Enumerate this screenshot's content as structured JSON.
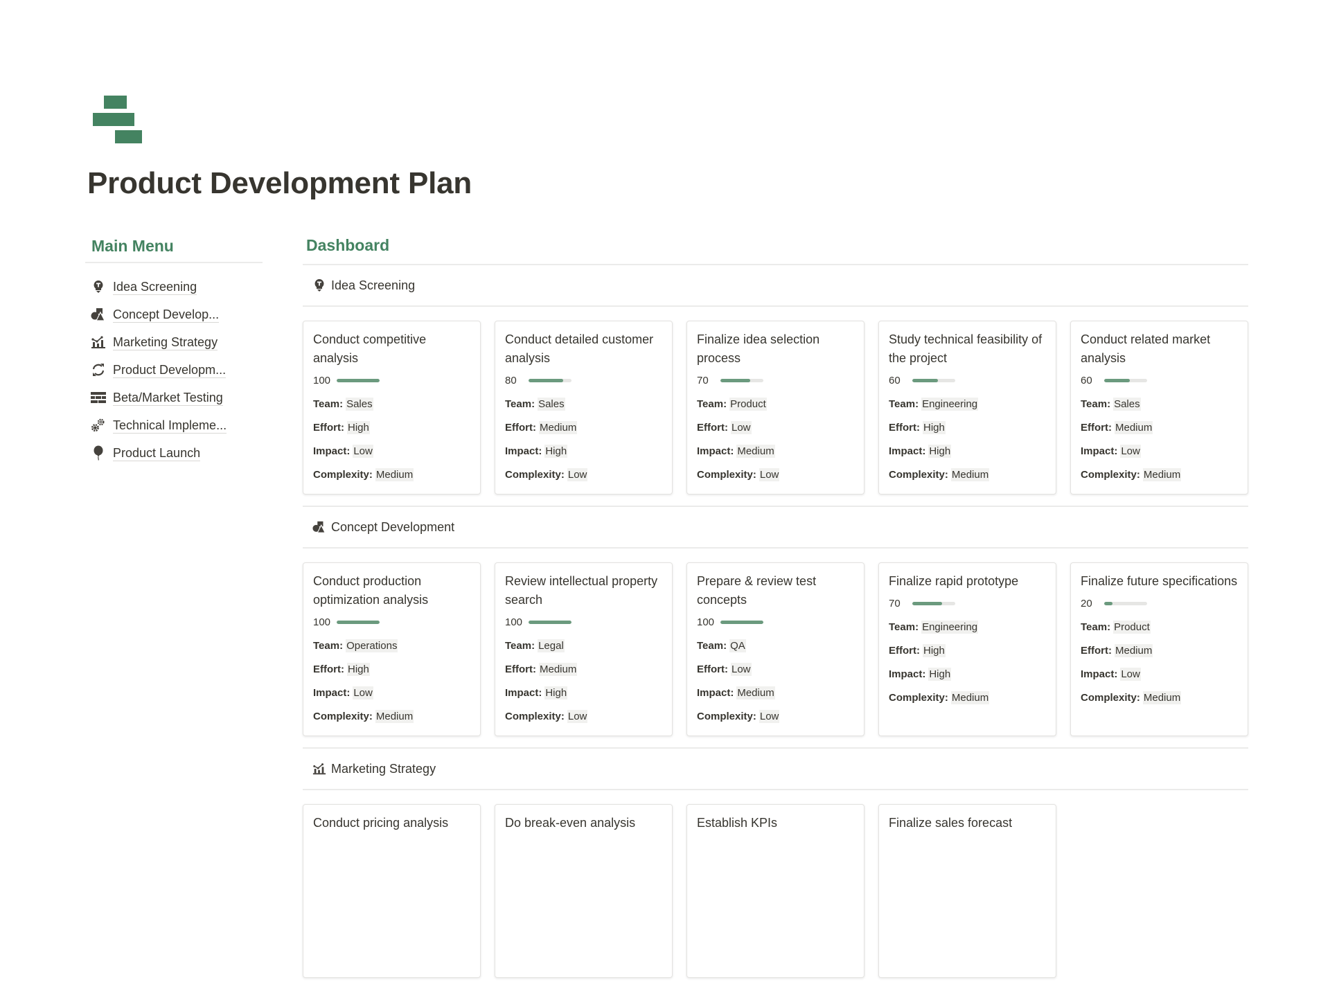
{
  "page": {
    "title": "Product Development Plan",
    "icon": "stacked-bars-icon",
    "accent_color": "#448361"
  },
  "sidebar": {
    "heading": "Main Menu",
    "items": [
      {
        "label": "Idea Screening",
        "icon": "lightbulb-icon"
      },
      {
        "label": "Concept Develop...",
        "icon": "shapes-icon"
      },
      {
        "label": "Marketing Strategy",
        "icon": "chart-icon"
      },
      {
        "label": "Product Developm...",
        "icon": "refresh-icon"
      },
      {
        "label": "Beta/Market Testing",
        "icon": "bricks-icon"
      },
      {
        "label": "Technical Impleme...",
        "icon": "gears-icon"
      },
      {
        "label": "Product Launch",
        "icon": "balloon-icon"
      }
    ]
  },
  "dashboard": {
    "title": "Dashboard",
    "labels": {
      "team": "Team:",
      "effort": "Effort:",
      "impact": "Impact:",
      "complexity": "Complexity:"
    },
    "sections": [
      {
        "name": "Idea Screening",
        "icon": "lightbulb-icon",
        "cards": [
          {
            "title": "Conduct competitive analysis",
            "progress": 100,
            "team": "Sales",
            "effort": "High",
            "impact": "Low",
            "complexity": "Medium"
          },
          {
            "title": "Conduct detailed customer analysis",
            "progress": 80,
            "team": "Sales",
            "effort": "Medium",
            "impact": "High",
            "complexity": "Low"
          },
          {
            "title": "Finalize idea selection process",
            "progress": 70,
            "team": "Product",
            "effort": "Low",
            "impact": "Medium",
            "complexity": "Low"
          },
          {
            "title": "Study technical feasibility of the project",
            "progress": 60,
            "team": "Engineering",
            "effort": "High",
            "impact": "High",
            "complexity": "Medium"
          },
          {
            "title": "Conduct related market analysis",
            "progress": 60,
            "team": "Sales",
            "effort": "Medium",
            "impact": "Low",
            "complexity": "Medium"
          }
        ]
      },
      {
        "name": "Concept Development",
        "icon": "shapes-icon",
        "cards": [
          {
            "title": "Conduct production optimization analysis",
            "progress": 100,
            "team": "Operations",
            "effort": "High",
            "impact": "Low",
            "complexity": "Medium"
          },
          {
            "title": "Review intellectual property search",
            "progress": 100,
            "team": "Legal",
            "effort": "Medium",
            "impact": "High",
            "complexity": "Low"
          },
          {
            "title": "Prepare & review test concepts",
            "progress": 100,
            "team": "QA",
            "effort": "Low",
            "impact": "Medium",
            "complexity": "Low"
          },
          {
            "title": "Finalize rapid prototype",
            "progress": 70,
            "team": "Engineering",
            "effort": "High",
            "impact": "High",
            "complexity": "Medium"
          },
          {
            "title": "Finalize future specifications",
            "progress": 20,
            "team": "Product",
            "effort": "Medium",
            "impact": "Low",
            "complexity": "Medium"
          }
        ]
      },
      {
        "name": "Marketing Strategy",
        "icon": "chart-icon",
        "cards": [
          {
            "title": "Conduct pricing analysis"
          },
          {
            "title": "Do break-even analysis"
          },
          {
            "title": "Establish KPIs"
          },
          {
            "title": "Finalize sales forecast"
          }
        ]
      }
    ]
  }
}
